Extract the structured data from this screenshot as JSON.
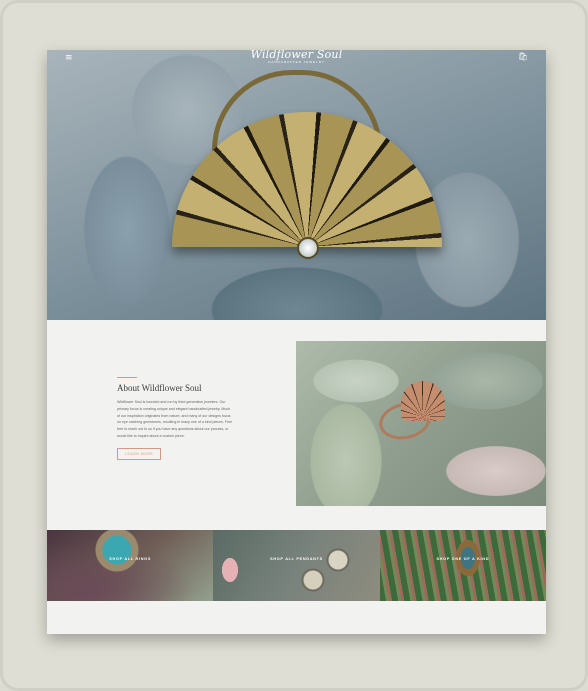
{
  "header": {
    "logo_name": "Wildflower Soul",
    "logo_tagline": "HANDCRAFTED JEWELRY",
    "menu_icon": "hamburger-icon",
    "cart_icon": "cart-icon",
    "menu_glyph": "≡",
    "cart_glyph": "🛍"
  },
  "about": {
    "heading": "About Wildflower Soul",
    "body": "Wildflower Soul is founded and run by third generation jewelers. Our primary focus is creating unique and elegant handcrafted jewelry. Much of our inspiration originates from nature, and many of our designs focus on eye catching gemstones, resulting in many one of a kind pieces. Feel free to reach out to us if you have any questions about our process, or would like to inquire about a custom piece.",
    "button_label": "LEARN MORE"
  },
  "shop_tiles": [
    {
      "label": "SHOP ALL RINGS"
    },
    {
      "label": "SHOP ALL PENDANTS"
    },
    {
      "label": "SHOP ONE OF A KIND"
    }
  ],
  "colors": {
    "accent": "#d29a7e",
    "page_bg": "#f2f2f0",
    "frame_bg": "#deded4"
  }
}
